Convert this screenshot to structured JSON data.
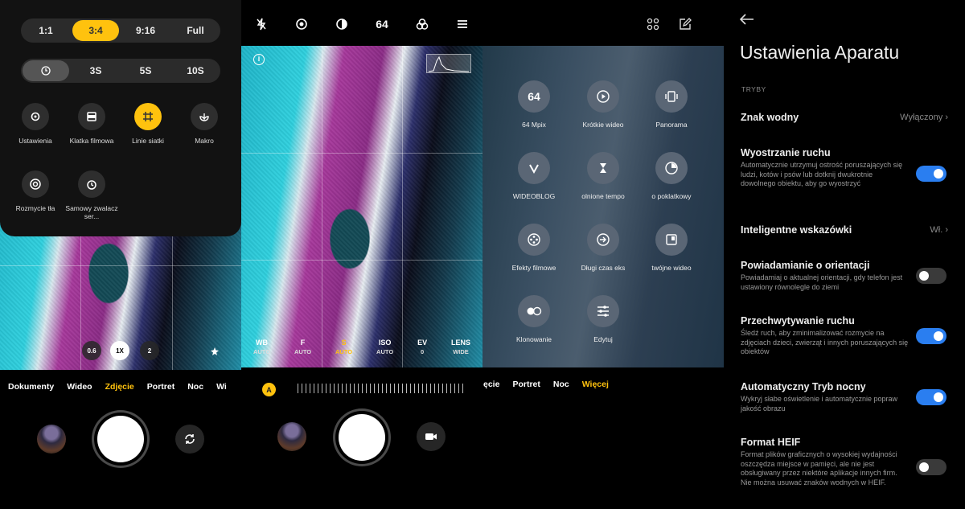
{
  "panel1": {
    "aspect_options": [
      "1:1",
      "3:4",
      "9:16",
      "Full"
    ],
    "aspect_selected": "3:4",
    "timer_options": [
      "3S",
      "5S",
      "10S"
    ],
    "tiles": [
      {
        "label": "Ustawienia",
        "icon": "gear-icon"
      },
      {
        "label": "Klatka filmowa",
        "icon": "frame-icon"
      },
      {
        "label": "Linie siatki",
        "icon": "grid-icon",
        "active": true
      },
      {
        "label": "Makro",
        "icon": "macro-icon"
      },
      {
        "label": "Rozmycie tła",
        "icon": "blur-icon"
      },
      {
        "label": "Samowy zwalacz ser...",
        "icon": "self-timer-icon"
      }
    ],
    "zoom": [
      "0.6",
      "1X",
      "2"
    ],
    "zoom_active": "1X",
    "modes": [
      "Dokumenty",
      "Wideo",
      "Zdjęcie",
      "Portret",
      "Noc",
      "Wi"
    ],
    "mode_active": "Zdjęcie"
  },
  "panel2": {
    "top_icons": [
      "flash-off-icon",
      "hdr-icon",
      "contrast-icon",
      "64",
      "filter-icon",
      "menu-icon"
    ],
    "top_number": "64",
    "pro_params": [
      {
        "key": "WB",
        "value": "AUTO"
      },
      {
        "key": "F",
        "value": "AUTO"
      },
      {
        "key": "S",
        "value": "AUTO",
        "active": true
      },
      {
        "key": "ISO",
        "value": "AUTO"
      },
      {
        "key": "EV",
        "value": "0"
      },
      {
        "key": "LENS",
        "value": "WIDE"
      }
    ],
    "auto_badge": "A"
  },
  "panel3": {
    "top_icons": [
      "grid-apps-icon",
      "edit-icon"
    ],
    "modes": [
      {
        "label": "64 Mpix",
        "icon": "64"
      },
      {
        "label": "Krótkie wideo",
        "icon": "play-icon"
      },
      {
        "label": "Panorama",
        "icon": "panorama-icon"
      },
      {
        "label": "WIDEOBLOG",
        "icon": "vlog-icon"
      },
      {
        "label": "olnione tempo",
        "icon": "hourglass-icon"
      },
      {
        "label": "o poklatkowy",
        "icon": "timelapse-icon"
      },
      {
        "label": "Efekty filmowe",
        "icon": "film-effects-icon"
      },
      {
        "label": "Długi czas eks",
        "icon": "long-exposure-icon"
      },
      {
        "label": "twójne wideo",
        "icon": "dual-video-icon"
      },
      {
        "label": "Klonowanie",
        "icon": "clone-icon"
      },
      {
        "label": "Edytuj",
        "icon": "sliders-icon"
      }
    ],
    "mode_tabs": [
      "ęcie",
      "Portret",
      "Noc",
      "Więcej"
    ],
    "mode_active": "Więcej"
  },
  "panel4": {
    "title": "Ustawienia Aparatu",
    "section": "TRYBY",
    "rows": [
      {
        "title": "Znak wodny",
        "value": "Wyłączony"
      },
      {
        "title": "Wyostrzanie ruchu",
        "desc": "Automatycznie utrzymuj ostrość poruszających się ludzi, kotów i psów lub dotknij dwukrotnie dowolnego obiektu, aby go wyostrzyć",
        "toggle": true
      },
      {
        "title": "Inteligentne wskazówki",
        "value": "Wł."
      },
      {
        "title": "Powiadamianie o orientacji",
        "desc": "Powiadamiaj o aktualnej orientacji, gdy telefon jest ustawiony równolegle do ziemi",
        "toggle": false
      },
      {
        "title": "Przechwytywanie ruchu",
        "desc": "Śledź ruch, aby zminimalizować rozmycie na zdjęciach dzieci, zwierząt i innych poruszających się obiektów",
        "toggle": true
      },
      {
        "title": "Automatyczny Tryb nocny",
        "desc": "Wykryj słabe oświetlenie i automatycznie popraw jakość obrazu",
        "toggle": true
      },
      {
        "title": "Format HEIF",
        "desc": "Format plików graficznych o wysokiej wydajności oszczędza miejsce w pamięci, ale nie jest obsługiwany przez niektóre aplikacje innych firm. Nie można usuwać znaków wodnych w HEIF.",
        "toggle": false
      }
    ],
    "accent": "#2a7ef0"
  },
  "colors": {
    "accent_yellow": "#ffc20e"
  }
}
